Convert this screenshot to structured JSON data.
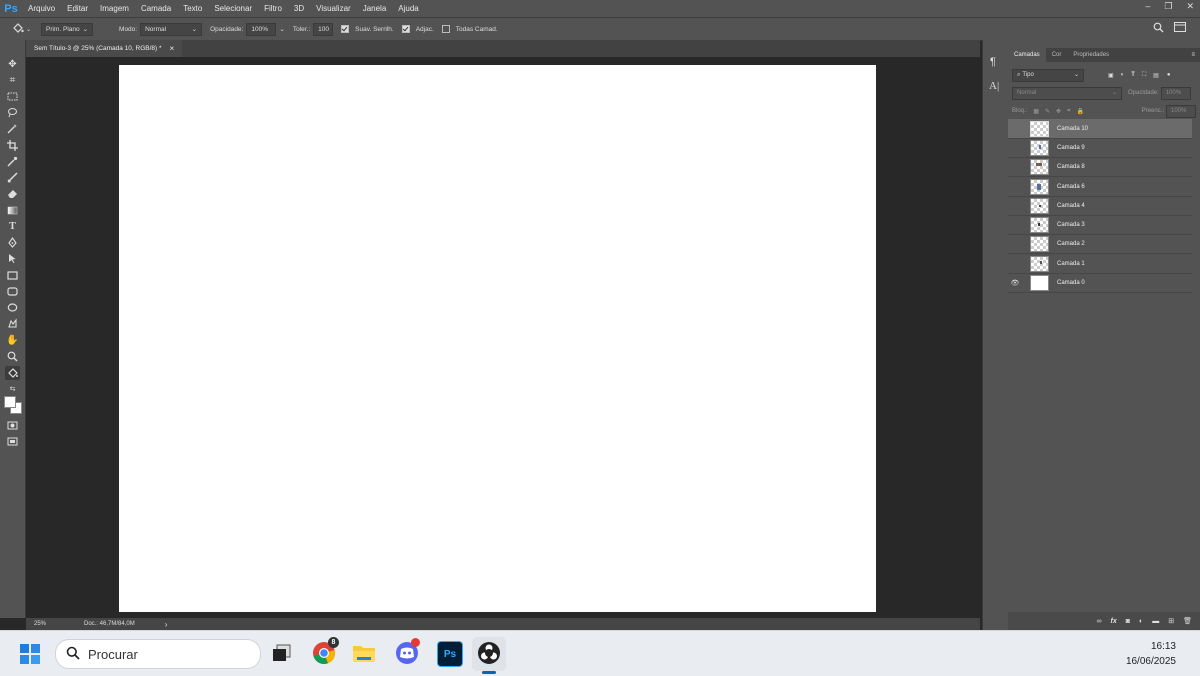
{
  "app": {
    "logo": "Ps",
    "menu": [
      "Arquivo",
      "Editar",
      "Imagem",
      "Camada",
      "Texto",
      "Selecionar",
      "Filtro",
      "3D",
      "Visualizar",
      "Janela",
      "Ajuda"
    ]
  },
  "options": {
    "fill_source": "Prim. Plano",
    "mode_label": "Modo:",
    "mode_value": "Normal",
    "opacity_label": "Opacidade:",
    "opacity_value": "100%",
    "tolerance_label": "Toler.:",
    "tolerance_value": "100",
    "anti_alias": "Suav. Serrilh.",
    "contiguous": "Adjac.",
    "all_layers": "Todas Camad."
  },
  "document": {
    "tab_title": "Sem Título-3 @ 25% (Camada 10, RGB/8) *",
    "close": "×"
  },
  "status": {
    "zoom": "25%",
    "doc_info": "Doc.: 46,7M/84,0M",
    "arrow": "›"
  },
  "panel": {
    "tabs": [
      "Camadas",
      "Cor",
      "Propriedades"
    ],
    "filter_label": "Tipo",
    "blend_mode": "Normal",
    "opacity_label": "Opacidade:",
    "opacity_value": "100%",
    "lock_label": "Bloq.:",
    "fill_label": "Preenc.:",
    "fill_value": "100%",
    "layers": [
      {
        "name": "Camada 10"
      },
      {
        "name": "Camada 9"
      },
      {
        "name": "Camada 8"
      },
      {
        "name": "Camada 6"
      },
      {
        "name": "Camada 4"
      },
      {
        "name": "Camada 3"
      },
      {
        "name": "Camada 2"
      },
      {
        "name": "Camada 1"
      },
      {
        "name": "Camada 0"
      }
    ]
  },
  "taskbar": {
    "search_placeholder": "Procurar",
    "time": "16:13",
    "date": "16/06/2025",
    "chrome_badge": "8"
  }
}
